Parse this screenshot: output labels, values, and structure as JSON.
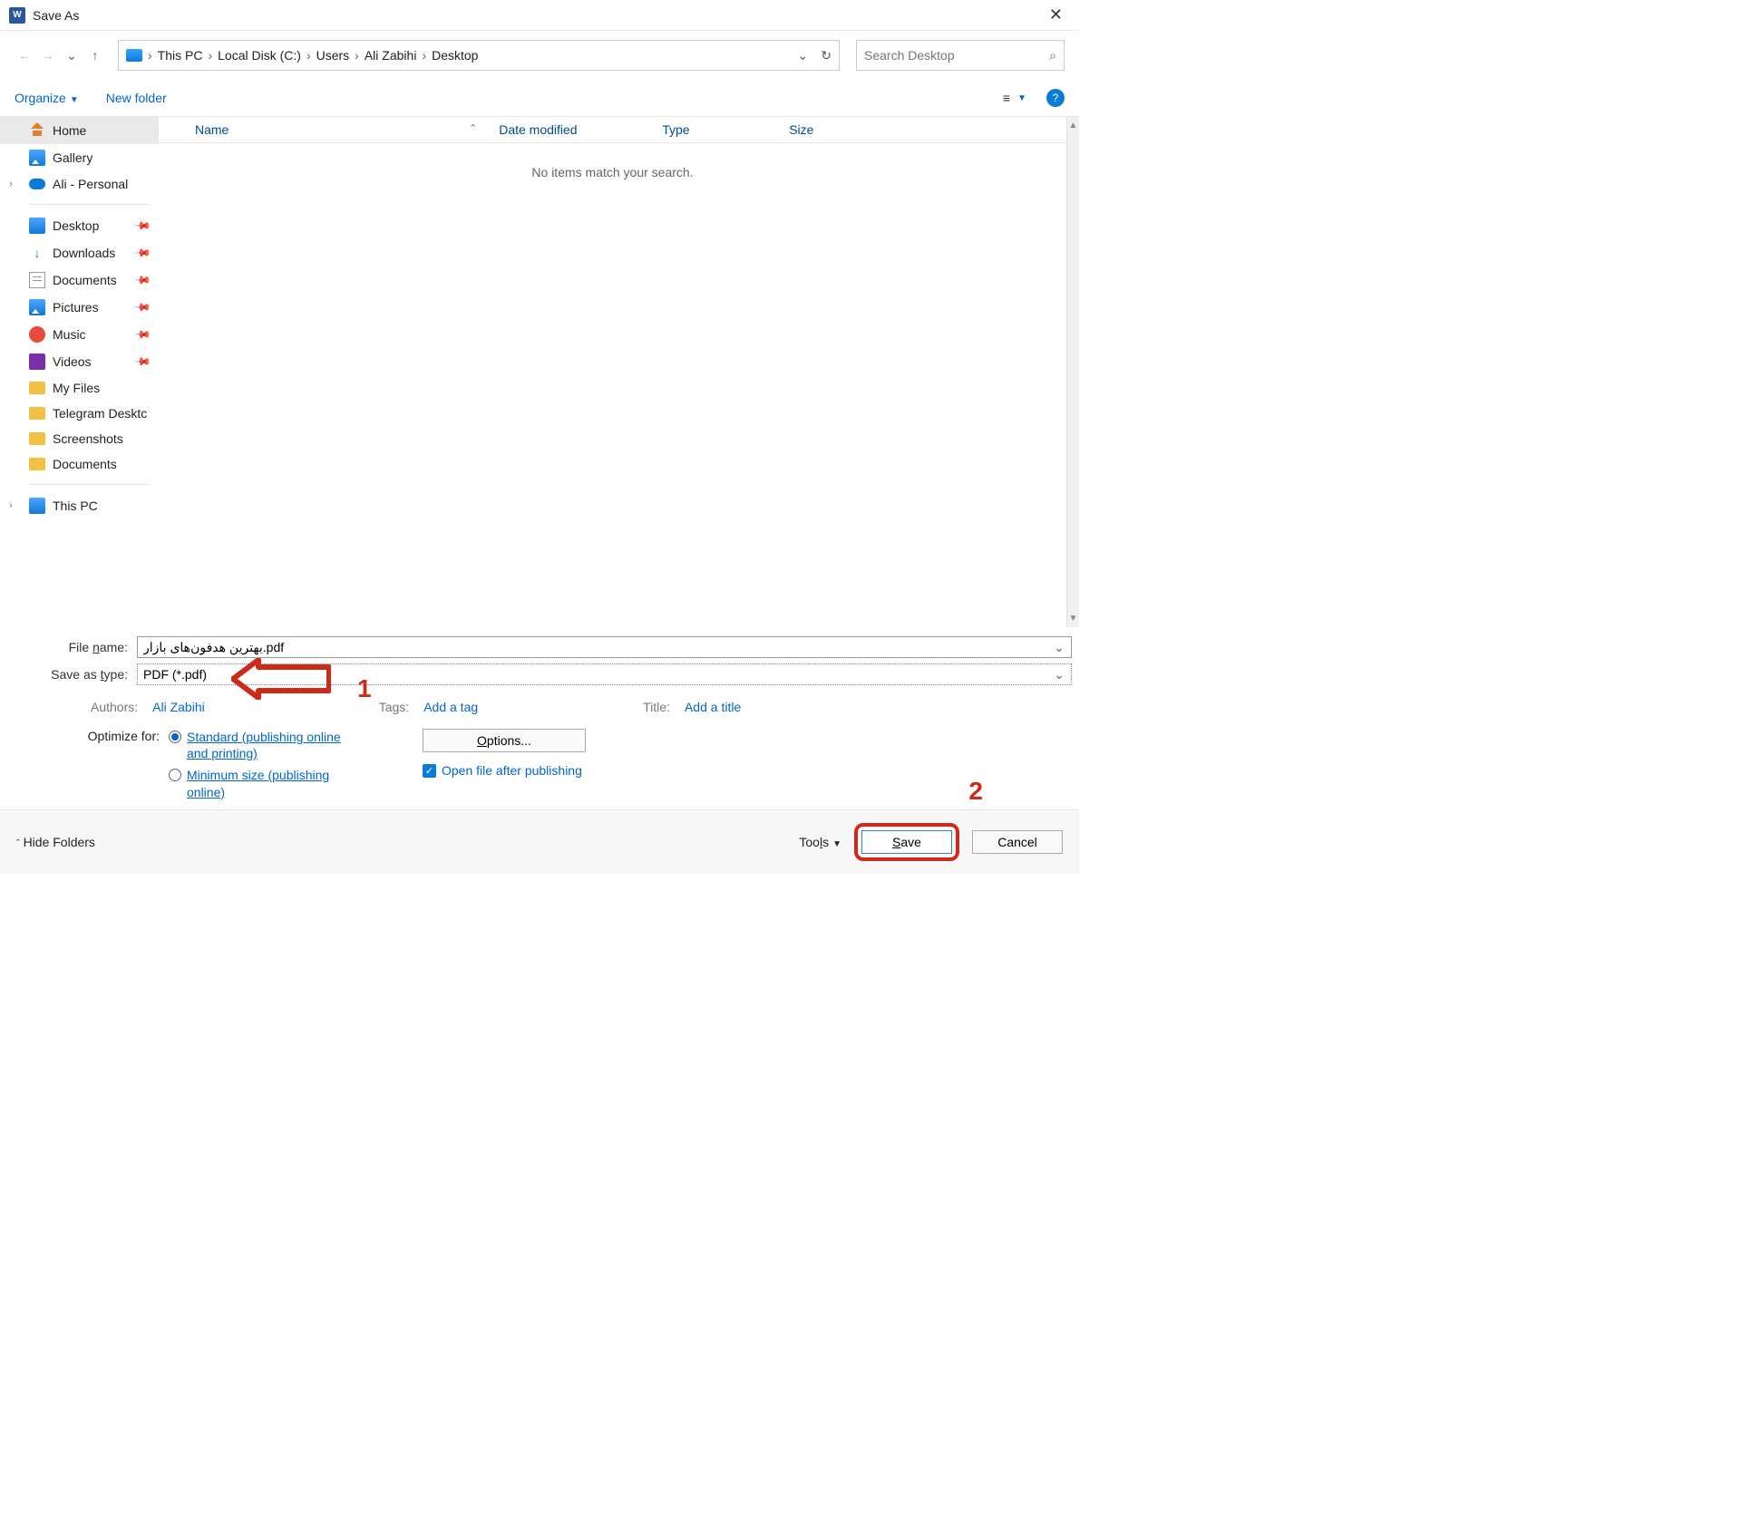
{
  "window": {
    "title": "Save As"
  },
  "breadcrumb": [
    "This PC",
    "Local Disk (C:)",
    "Users",
    "Ali Zabihi",
    "Desktop"
  ],
  "search": {
    "placeholder": "Search Desktop"
  },
  "toolbar": {
    "organize": "Organize",
    "newfolder": "New folder"
  },
  "sidebar": {
    "home": "Home",
    "gallery": "Gallery",
    "onedrive": "Ali - Personal",
    "desktop": "Desktop",
    "downloads": "Downloads",
    "documents": "Documents",
    "pictures": "Pictures",
    "music": "Music",
    "videos": "Videos",
    "myfiles": "My Files",
    "telegram": "Telegram Desktc",
    "screenshots": "Screenshots",
    "documents2": "Documents",
    "thispc": "This PC"
  },
  "columns": {
    "name": "Name",
    "date": "Date modified",
    "type": "Type",
    "size": "Size"
  },
  "empty": "No items match your search.",
  "form": {
    "filename_label": "File name:",
    "filename_value": "بهترین هدفون‌های بازار.pdf",
    "type_label": "Save as type:",
    "type_value": "PDF (*.pdf)",
    "authors_label": "Authors:",
    "authors_value": "Ali Zabihi",
    "tags_label": "Tags:",
    "tags_value": "Add a tag",
    "title_label": "Title:",
    "title_value": "Add a title",
    "optimize_label": "Optimize for:",
    "opt_standard": "Standard (publishing online and printing)",
    "opt_minimum": "Minimum size (publishing online)",
    "options_btn": "Options...",
    "open_after": "Open file after publishing"
  },
  "footer": {
    "hide": "Hide Folders",
    "tools": "Tools",
    "save": "Save",
    "cancel": "Cancel"
  },
  "annot": {
    "one": "1",
    "two": "2"
  }
}
